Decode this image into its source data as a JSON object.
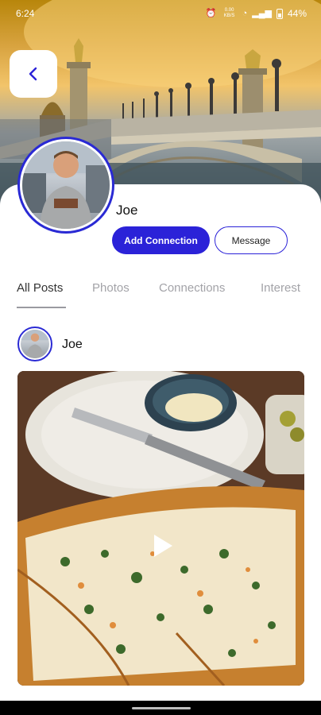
{
  "status_bar": {
    "time": "6:24",
    "network_speed": "0.00 KB/S",
    "battery": "44%"
  },
  "profile": {
    "name": "Joe",
    "add_connection_label": "Add Connection",
    "message_label": "Message"
  },
  "tabs": [
    {
      "label": "All Posts",
      "active": true
    },
    {
      "label": "Photos",
      "active": false
    },
    {
      "label": "Connections",
      "active": false
    },
    {
      "label": "Interest",
      "active": false
    }
  ],
  "post": {
    "author": "Joe",
    "media_type": "video"
  },
  "colors": {
    "accent": "#2b22d8",
    "avatar_ring": "#2a2ad4",
    "tab_inactive": "#a3a3a8"
  }
}
